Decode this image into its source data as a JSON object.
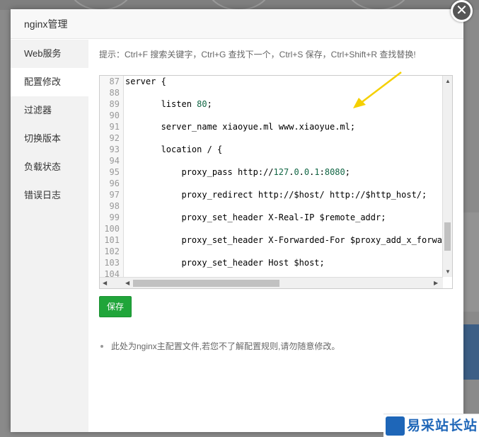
{
  "modal": {
    "title": "nginx管理",
    "close_glyph": "✕"
  },
  "sidebar": {
    "items": [
      {
        "label": "Web服务"
      },
      {
        "label": "配置修改"
      },
      {
        "label": "过滤器"
      },
      {
        "label": "切换版本"
      },
      {
        "label": "负载状态"
      },
      {
        "label": "错误日志"
      }
    ],
    "active_index": 1
  },
  "editor": {
    "hint": "提示：Ctrl+F 搜索关键字，Ctrl+G 查找下一个，Ctrl+S 保存，Ctrl+Shift+R 查找替换!",
    "lines": [
      {
        "n": "87",
        "text": "server {"
      },
      {
        "n": "88",
        "text": ""
      },
      {
        "n": "89",
        "text": "       listen 80;"
      },
      {
        "n": "90",
        "text": ""
      },
      {
        "n": "91",
        "text": "       server_name xiaoyue.ml www.xiaoyue.ml;"
      },
      {
        "n": "92",
        "text": ""
      },
      {
        "n": "93",
        "text": "       location / {"
      },
      {
        "n": "94",
        "text": ""
      },
      {
        "n": "95",
        "text": "           proxy_pass http://127.0.0.1:8080;"
      },
      {
        "n": "96",
        "text": ""
      },
      {
        "n": "97",
        "text": "           proxy_redirect http://$host/ http://$http_host/;"
      },
      {
        "n": "98",
        "text": ""
      },
      {
        "n": "99",
        "text": "           proxy_set_header X-Real-IP $remote_addr;"
      },
      {
        "n": "100",
        "text": ""
      },
      {
        "n": "101",
        "text": "           proxy_set_header X-Forwarded-For $proxy_add_x_forwa"
      },
      {
        "n": "102",
        "text": ""
      },
      {
        "n": "103",
        "text": "           proxy_set_header Host $host;"
      },
      {
        "n": "104",
        "text": ""
      }
    ]
  },
  "actions": {
    "save_label": "保存"
  },
  "notes": [
    "此处为nginx主配置文件,若您不了解配置规则,请勿随意修改。"
  ],
  "watermark": {
    "text": "易采站长站"
  },
  "colors": {
    "accent_green": "#20a53a",
    "arrow_yellow": "#f5d000",
    "number_green": "#116644"
  }
}
